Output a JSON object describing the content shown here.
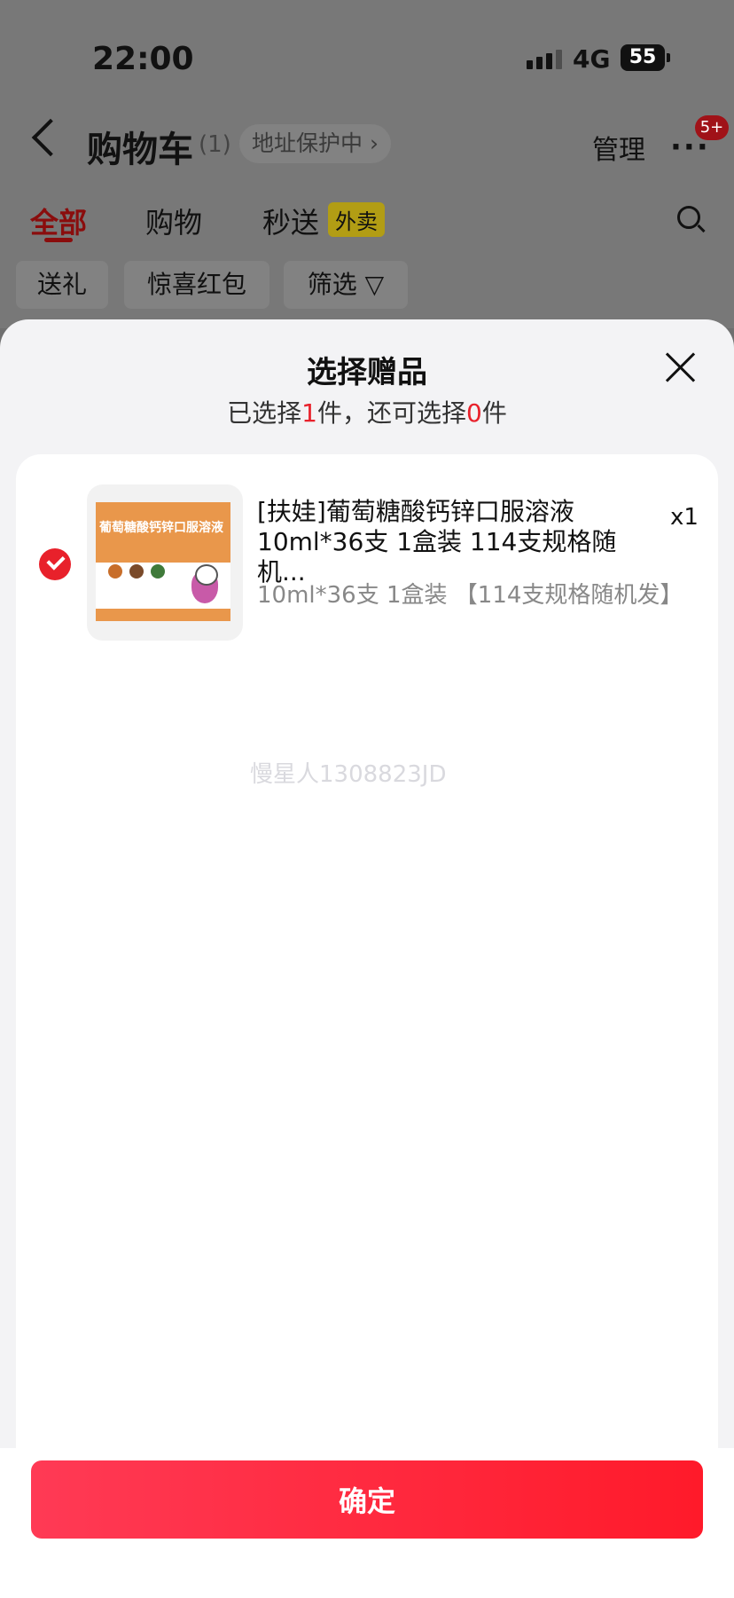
{
  "status_bar": {
    "time": "22:00",
    "network": "4G",
    "battery": "55"
  },
  "header": {
    "title": "购物车",
    "count": "(1)",
    "address_protect": "地址保护中 ›",
    "manage": "管理",
    "more": "···",
    "more_badge": "5+"
  },
  "tabs": [
    {
      "label": "全部"
    },
    {
      "label": "购物"
    },
    {
      "label": "秒送"
    }
  ],
  "tab_tag": "外卖",
  "filters": [
    {
      "label": "送礼"
    },
    {
      "label": "惊喜红包"
    },
    {
      "label": "筛选 ▽"
    }
  ],
  "sheet": {
    "title": "选择赠品",
    "sub_prefix": "已选择",
    "selected_count": "1",
    "sub_mid": "件，还可选择",
    "remaining_count": "0",
    "sub_suffix": "件"
  },
  "item": {
    "name": "[扶娃]葡萄糖酸钙锌口服溶液 10ml*36支 1盒装 114支规格随机...",
    "quantity": "x1",
    "spec": "10ml*36支 1盒装 【114支规格随机发】",
    "box_label": "葡萄糖酸钙锌口服溶液",
    "checked": true
  },
  "watermark": "慢星人1308823JD",
  "confirm_label": "确定",
  "colors": {
    "accent": "#e8212b",
    "button_start": "#ff3a55",
    "button_end": "#ff1a2a"
  }
}
